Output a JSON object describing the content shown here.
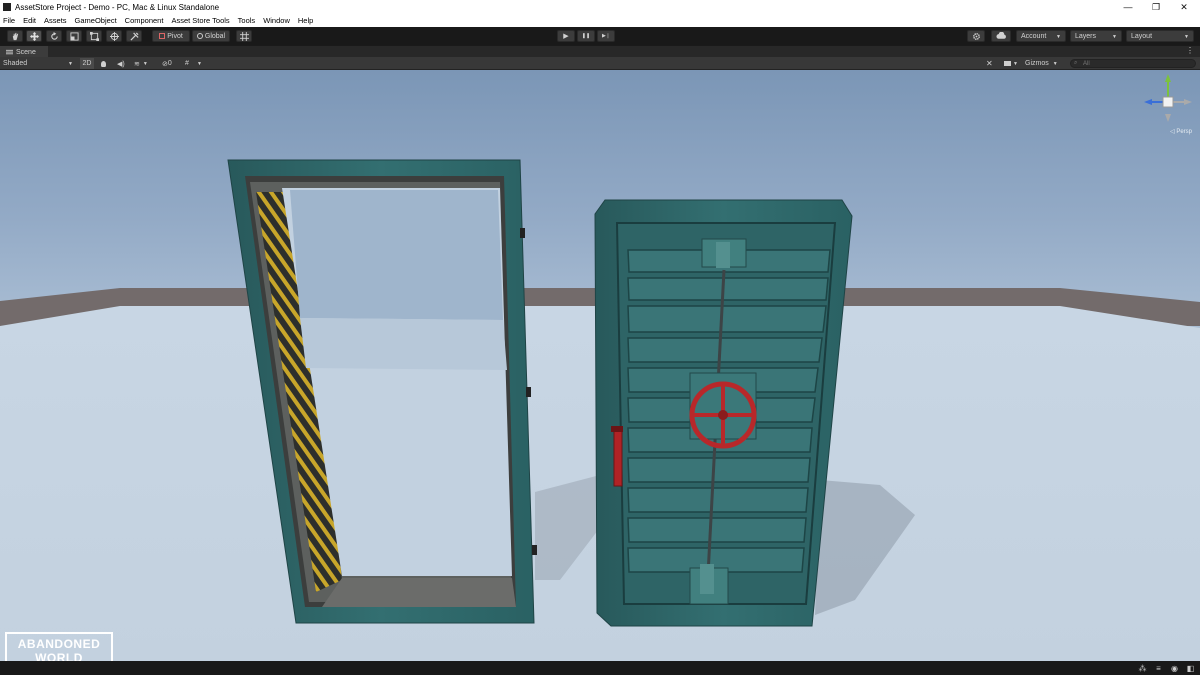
{
  "window": {
    "title": "AssetStore Project - Demo - PC, Mac & Linux Standalone",
    "minimize": "—",
    "restore": "❐",
    "close": "✕"
  },
  "menu": [
    "File",
    "Edit",
    "Assets",
    "GameObject",
    "Component",
    "Asset Store Tools",
    "Tools",
    "Window",
    "Help"
  ],
  "toolbar": {
    "tools": [
      "hand-icon",
      "move-icon",
      "rotate-icon",
      "scale-icon",
      "rect-icon",
      "transform-icon",
      "custom-tool-icon"
    ],
    "pivot_label": "Pivot",
    "global_label": "Global",
    "play": "▶",
    "pause": "❚❚",
    "step": "▶❘",
    "account_label": "Account",
    "layers_label": "Layers",
    "layout_label": "Layout"
  },
  "scene": {
    "tab_label": "Scene",
    "shading_mode": "Shaded",
    "mode_2d": "2D",
    "hidden_count": "0",
    "gizmos_label": "Gizmos",
    "search_placeholder": "All",
    "projection_label": "◁ Persp"
  },
  "watermark": {
    "line1": "ABANDONED",
    "line2": "WORLD"
  },
  "colors": {
    "door_teal": "#2f6a6c",
    "valve_red": "#b8282a",
    "hazard_yellow": "#c8a62a",
    "editor_dark": "#191919"
  }
}
